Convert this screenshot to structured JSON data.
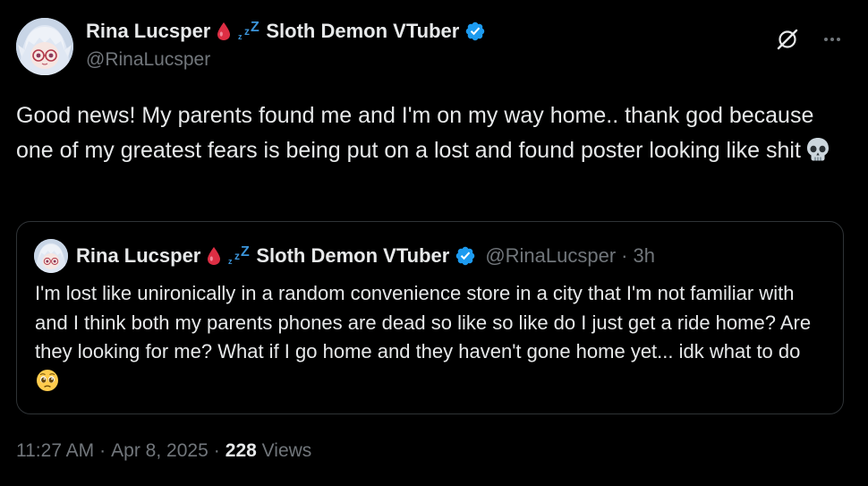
{
  "author": {
    "display_name": "Rina Lucsper",
    "display_name_suffix": "Sloth Demon VTuber",
    "handle": "@RinaLucsper",
    "verified": true
  },
  "tweet": {
    "text": "Good news! My parents found me and I'm on my way home.. thank god because one of my greatest fears is being put on a lost and found poster looking like shit",
    "emoji": "skull-emoji"
  },
  "quoted_tweet": {
    "display_name": "Rina Lucsper",
    "display_name_suffix": "Sloth Demon VTuber",
    "handle": "@RinaLucsper",
    "separator": "·",
    "time_ago": "3h",
    "text": "I'm lost like unironically in a random convenience store in a city that I'm not familiar with and I think both my parents phones are dead so like so like do I just get a ride home? Are they looking for me? What if I go home and they haven't gone home yet... idk what to do",
    "emoji": "pleading-face-emoji"
  },
  "meta": {
    "time": "11:27 AM",
    "separator": "·",
    "date": "Apr 8, 2025",
    "views_count": "228",
    "views_label": "Views"
  },
  "colors": {
    "background": "#000000",
    "text_primary": "#e7e9ea",
    "text_secondary": "#71767b",
    "border": "#2f3336",
    "verified_blue": "#1d9bf0",
    "blood_red": "#e0245e",
    "zzz_blue": "#3b94d9"
  },
  "icons": {
    "grok": "grok-icon",
    "more": "more-horizontal-icon",
    "verified": "verified-badge-icon",
    "blood_drop": "blood-drop-icon",
    "zzz": "zzz-icon"
  }
}
